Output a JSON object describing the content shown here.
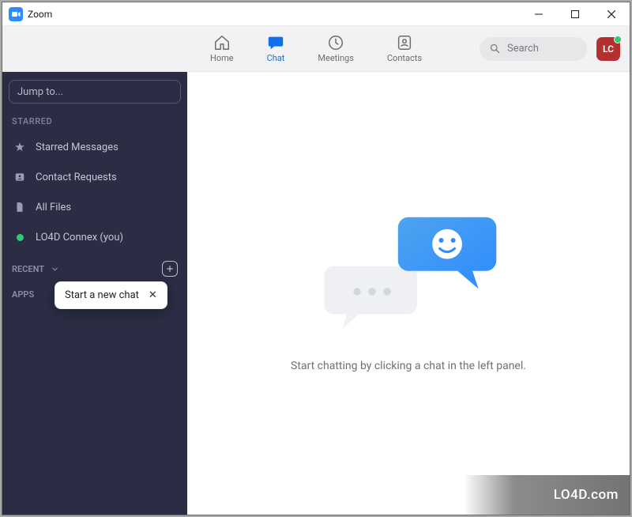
{
  "window": {
    "title": "Zoom"
  },
  "nav": {
    "home": "Home",
    "chat": "Chat",
    "meetings": "Meetings",
    "contacts": "Contacts",
    "search_placeholder": "Search",
    "avatar_initials": "LC"
  },
  "sidebar": {
    "jump_placeholder": "Jump to...",
    "starred_label": "STARRED",
    "items": [
      {
        "label": "Starred Messages"
      },
      {
        "label": "Contact Requests"
      },
      {
        "label": "All Files"
      },
      {
        "label": "LO4D Connex (you)"
      }
    ],
    "recent_label": "RECENT",
    "apps_label": "APPS",
    "tooltip": "Start a new chat"
  },
  "main": {
    "hint": "Start chatting by clicking a chat in the left panel."
  },
  "watermark": "LO4D.com"
}
